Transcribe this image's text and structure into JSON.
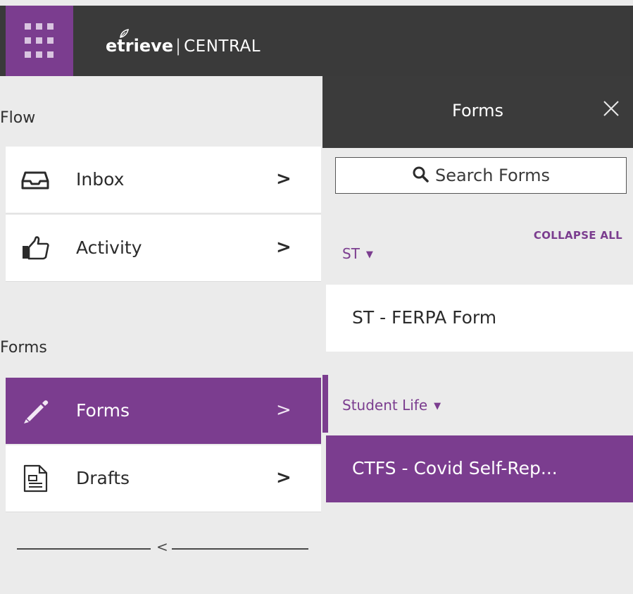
{
  "header": {
    "brand_name": "etrieve",
    "brand_separator": "|",
    "brand_product": "CENTRAL",
    "apps_icon": "grid-icon"
  },
  "sidebar": {
    "flow_section": "Flow",
    "forms_section": "Forms",
    "items": [
      {
        "label": "Inbox",
        "icon": "inbox-tray-icon",
        "chevron": ">"
      },
      {
        "label": "Activity",
        "icon": "pointing-hand-icon",
        "chevron": ">"
      },
      {
        "label": "Forms",
        "icon": "pencil-icon",
        "chevron": ">",
        "active": true
      },
      {
        "label": "Drafts",
        "icon": "document-icon",
        "chevron": ">"
      }
    ],
    "collapse_arrow": "<"
  },
  "panel": {
    "title": "Forms",
    "close_icon": "close-icon",
    "search_placeholder": "Search Forms",
    "collapse_all": "COLLAPSE ALL",
    "groups": [
      {
        "name": "ST",
        "caret": "▼",
        "forms": [
          "ST - FERPA Form"
        ]
      },
      {
        "name": "Student Life",
        "caret": "▼",
        "forms": [
          "CTFS - Covid Self-Rep..."
        ]
      }
    ]
  },
  "colors": {
    "accent": "#7b3d8f",
    "topbar": "#3a3a3a",
    "background": "#ebebeb"
  }
}
